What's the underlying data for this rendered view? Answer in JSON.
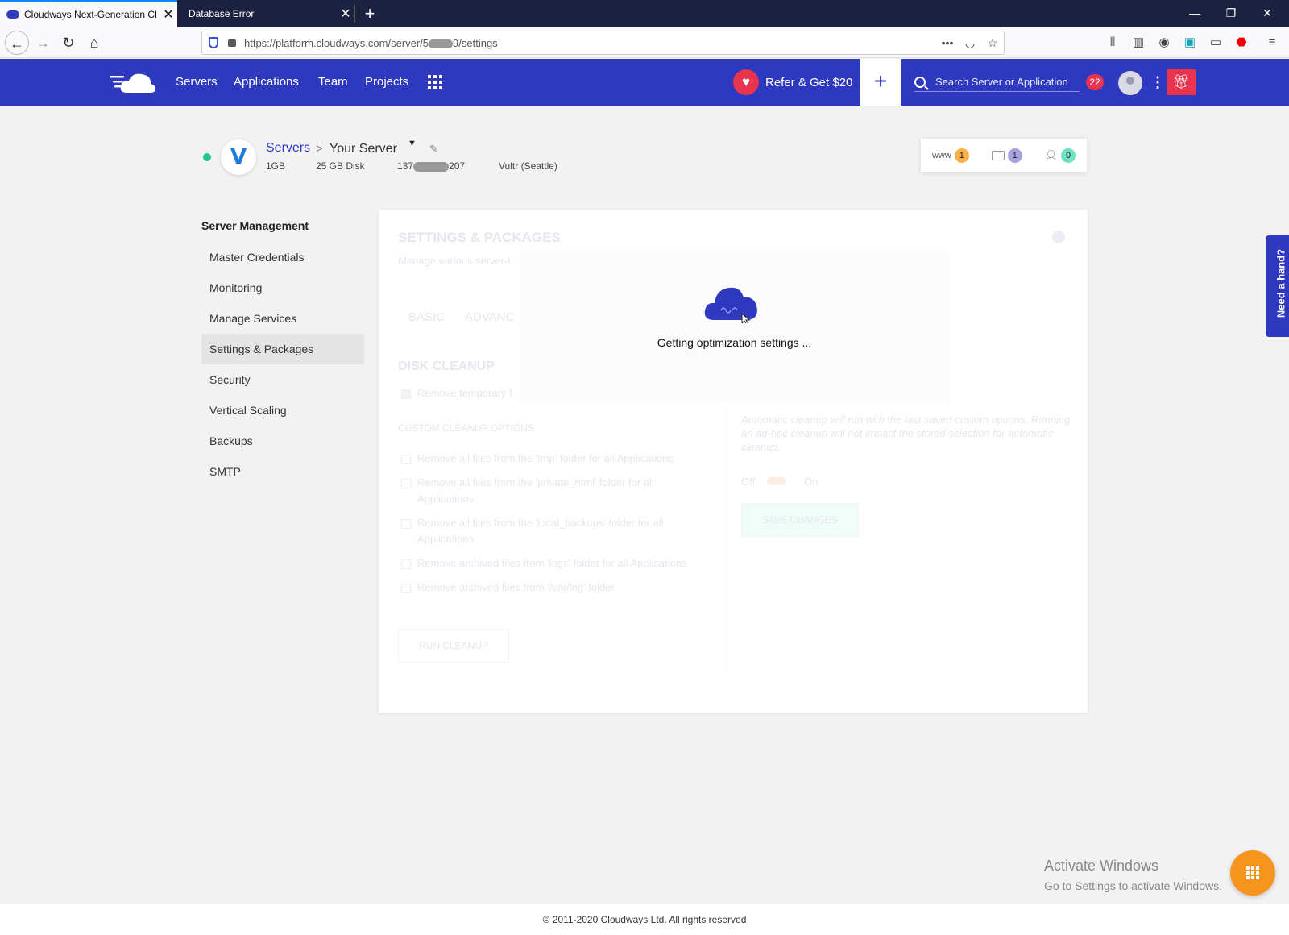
{
  "browser": {
    "tabs": [
      {
        "title": "Cloudways Next-Generation Cl",
        "close": "✕"
      },
      {
        "title": "Database Error",
        "close": "✕"
      }
    ],
    "new_tab": "+",
    "window_controls": {
      "minimize": "—",
      "restore": "❐",
      "close": "✕"
    },
    "url": "https://platform.cloudways.com/server/5",
    "url_end": "9/settings"
  },
  "header": {
    "nav": [
      "Servers",
      "Applications",
      "Team",
      "Projects"
    ],
    "refer_label": "Refer & Get $20",
    "add": "+",
    "search_placeholder": "Search Server or Application",
    "notification_count": "22"
  },
  "server": {
    "breadcrumb_root": "Servers",
    "breadcrumb_sep": ">",
    "name": "Your Server",
    "size": "1GB",
    "disk": "25 GB Disk",
    "ip_start": "137",
    "ip_end": "207",
    "provider": "Vultr (Seattle)",
    "stats": {
      "www_label": "www",
      "www": "1",
      "files": "1",
      "users": "0"
    }
  },
  "sidebar": {
    "title": "Server Management",
    "items": [
      "Master Credentials",
      "Monitoring",
      "Manage Services",
      "Settings & Packages",
      "Security",
      "Vertical Scaling",
      "Backups",
      "SMTP"
    ],
    "active": "Settings & Packages"
  },
  "panel": {
    "title": "SETTINGS & PACKAGES",
    "subtitle": "Manage various server-l",
    "tabs": [
      "BASIC",
      "ADVANC"
    ],
    "disk_cleanup": "DISK CLEANUP",
    "remove_temp": "Remove temporary f",
    "custom_options": "CUSTOM CLEANUP OPTIONS",
    "options": [
      "Remove all files from the 'tmp' folder for all Applications",
      "Remove all files from the 'private_html' folder for all Applications",
      "Remove all files from the 'local_backups' folder for all Applications",
      "Remove archived files from 'logs' folder for all Applications",
      "Remove archived files from '/var/log' folder"
    ],
    "note": "Automatic cleanup will run with the last saved custom options. Running an ad-hoc cleanup will not impact the stored selection for automatic cleanup.",
    "toggle_off": "Off",
    "toggle_on": "On",
    "save_label": "SAVE CHANGES",
    "run_cleanup": "RUN CLEANUP"
  },
  "loader": {
    "text": "Getting optimization settings ..."
  },
  "widgets": {
    "need_hand": "Need a hand?"
  },
  "os_watermark": {
    "line1": "Activate Windows",
    "line2": "Go to Settings to activate Windows."
  },
  "footer": "© 2011-2020 Cloudways Ltd. All rights reserved",
  "colors": {
    "brand": "#2f39bf",
    "accent_red": "#e8344e",
    "fab": "#f7941e",
    "online": "#21c98b"
  }
}
